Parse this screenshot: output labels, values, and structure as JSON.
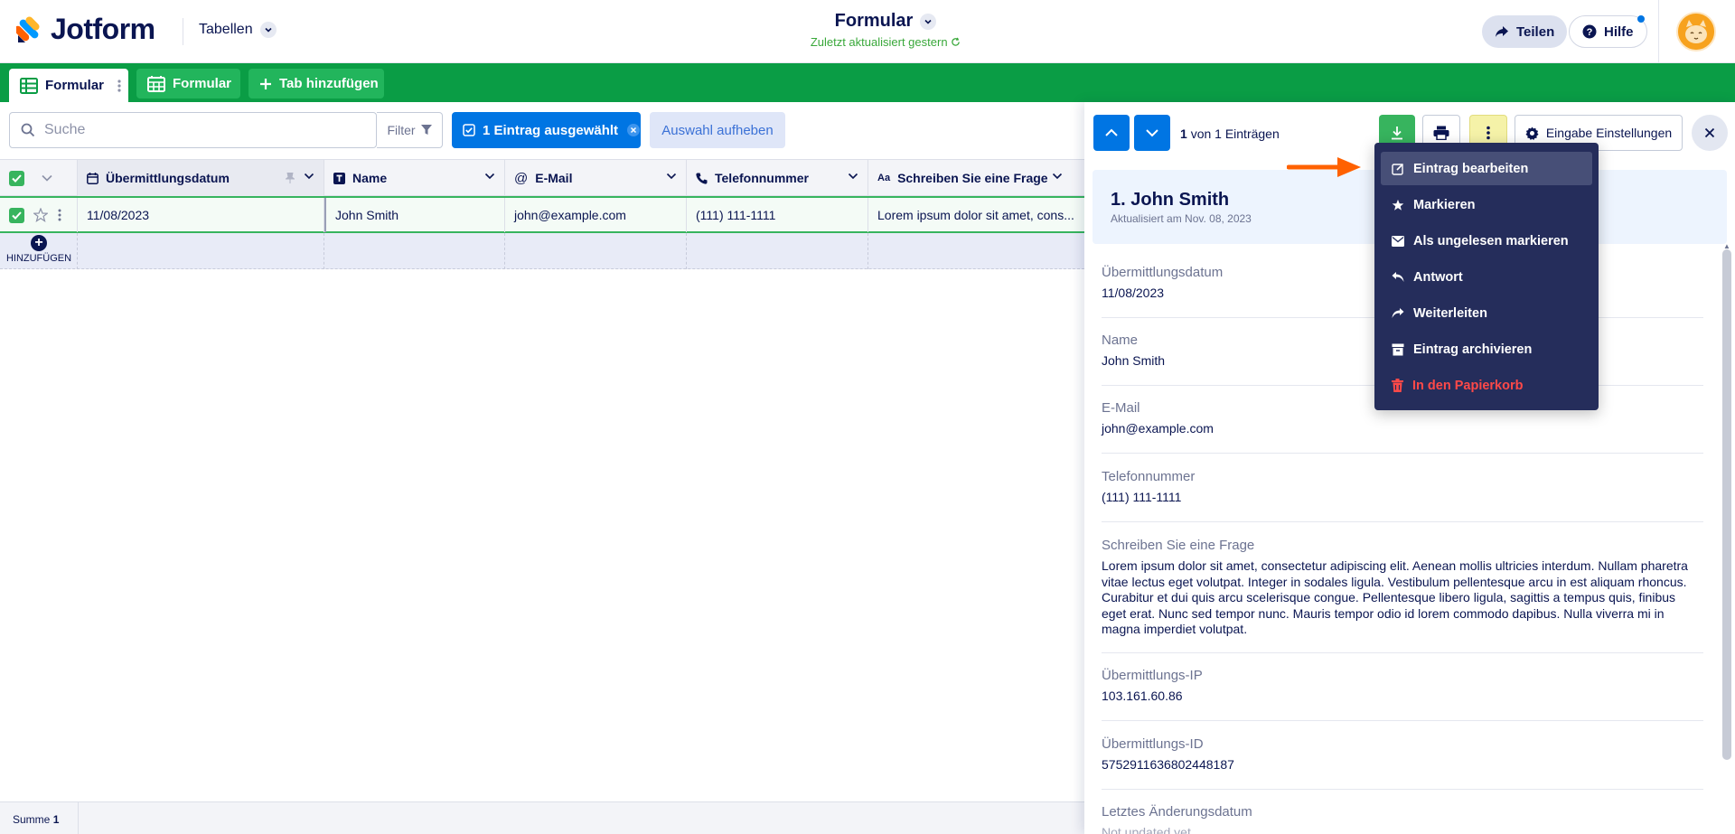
{
  "header": {
    "logo_text": "Jotform",
    "tables_label": "Tabellen",
    "form_title": "Formular",
    "last_updated": "Zuletzt aktualisiert gestern",
    "share_label": "Teilen",
    "help_label": "Hilfe"
  },
  "tabs": [
    {
      "label": "Formular"
    },
    {
      "label": "Formular"
    },
    {
      "label": "Tab hinzufügen"
    }
  ],
  "toolbar": {
    "search_placeholder": "Suche",
    "filter_label": "Filter",
    "selected_label": "1 Eintrag ausgewählt",
    "deselect_label": "Auswahl aufheben"
  },
  "grid": {
    "columns": [
      {
        "label": "Übermittlungsdatum",
        "icon": "calendar-icon"
      },
      {
        "label": "Name",
        "icon": "text-icon"
      },
      {
        "label": "E-Mail",
        "icon": "at-icon"
      },
      {
        "label": "Telefonnummer",
        "icon": "phone-icon"
      },
      {
        "label": "Schreiben Sie eine Frage",
        "icon": "aa-icon"
      }
    ],
    "row": {
      "date": "11/08/2023",
      "name": "John Smith",
      "email": "john@example.com",
      "phone": "(111) 111-1111",
      "question": "Lorem ipsum dolor sit amet, cons..."
    },
    "add_label": "HINZUFÜGEN",
    "footer_sum_label": "Summe",
    "footer_sum_value": "1"
  },
  "panel": {
    "count_num": "1",
    "count_text": "von 1 Einträgen",
    "settings_label": "Eingabe Einstellungen",
    "entry_title": "1. John Smith",
    "entry_updated": "Aktualisiert am Nov. 08, 2023",
    "fields": [
      {
        "label": "Übermittlungsdatum",
        "value": "11/08/2023"
      },
      {
        "label": "Name",
        "value": "John Smith"
      },
      {
        "label": "E-Mail",
        "value": "john@example.com"
      },
      {
        "label": "Telefonnummer",
        "value": "(111) 111-1111"
      },
      {
        "label": "Schreiben Sie eine Frage",
        "value": "Lorem ipsum dolor sit amet, consectetur adipiscing elit. Aenean mollis ultricies interdum. Nullam pharetra vitae lectus eget volutpat. Integer in sodales ligula. Vestibulum pellentesque arcu in est aliquam rhoncus. Curabitur et dui quis arcu scelerisque congue. Pellentesque libero ligula, sagittis a tempus quis, finibus eget erat. Nunc sed tempor nunc. Mauris tempor odio id lorem commodo dapibus. Nulla viverra mi in magna imperdiet volutpat."
      },
      {
        "label": "Übermittlungs-IP",
        "value": "103.161.60.86"
      },
      {
        "label": "Übermittlungs-ID",
        "value": "5752911636802448187"
      },
      {
        "label": "Letztes Änderungsdatum",
        "value": "Not updated yet"
      }
    ]
  },
  "menu": {
    "items": [
      {
        "label": "Eintrag bearbeiten",
        "icon": "edit-icon"
      },
      {
        "label": "Markieren",
        "icon": "star-icon"
      },
      {
        "label": "Als ungelesen markieren",
        "icon": "envelope-icon"
      },
      {
        "label": "Antwort",
        "icon": "reply-icon"
      },
      {
        "label": "Weiterleiten",
        "icon": "forward-icon"
      },
      {
        "label": "Eintrag archivieren",
        "icon": "archive-icon"
      },
      {
        "label": "In den Papierkorb",
        "icon": "trash-icon"
      }
    ]
  },
  "colors": {
    "brand_green": "#0a9d45",
    "primary_blue": "#0075e3",
    "menu_bg": "#252d5b",
    "danger": "#ff4948",
    "arrow": "#ff6100"
  }
}
